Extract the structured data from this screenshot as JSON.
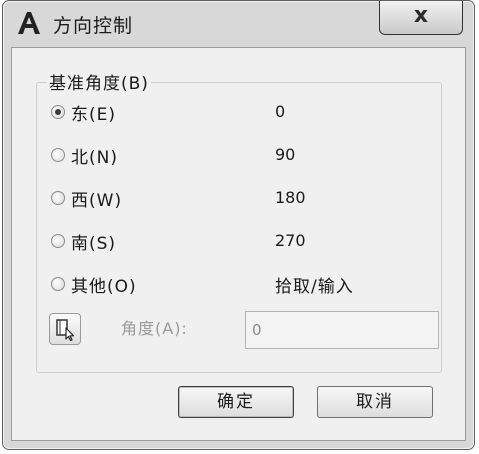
{
  "window": {
    "title": "方向控制",
    "close_label": "x"
  },
  "base_angle_group": {
    "title": "基准角度(B)",
    "options": [
      {
        "label": "东(E)",
        "value": "0",
        "checked": true
      },
      {
        "label": "北(N)",
        "value": "90",
        "checked": false
      },
      {
        "label": "西(W)",
        "value": "180",
        "checked": false
      },
      {
        "label": "南(S)",
        "value": "270",
        "checked": false
      },
      {
        "label": "其他(O)",
        "value": "拾取/输入",
        "checked": false
      }
    ],
    "angle_label": "角度(A):",
    "angle_value": "0"
  },
  "buttons": {
    "ok_label": "确定",
    "cancel_label": "取消"
  },
  "icons": {
    "app": "autocad-a-icon",
    "pick": "pick-point-cursor-icon",
    "close": "close-icon"
  }
}
